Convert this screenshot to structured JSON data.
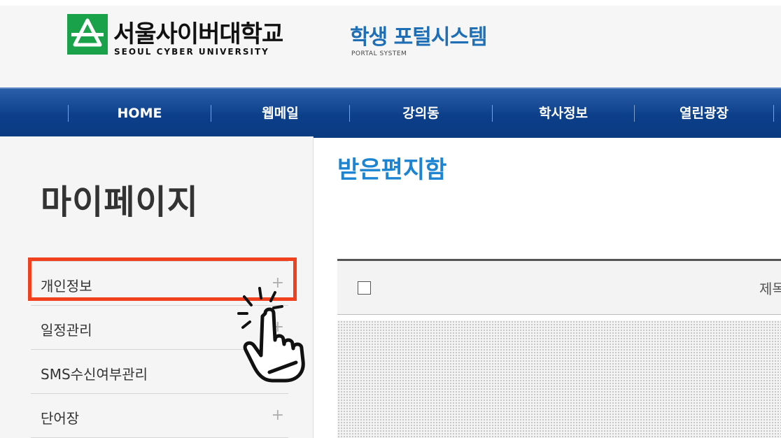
{
  "header": {
    "logo_korean": "서울사이버대학교",
    "logo_english": "SEOUL CYBER UNIVERSITY",
    "portal_korean": "학생 포털시스템",
    "portal_english": "PORTAL SYSTEM"
  },
  "nav": {
    "items": [
      "HOME",
      "웹메일",
      "강의동",
      "학사정보",
      "열린광장"
    ]
  },
  "sidebar": {
    "title": "마이페이지",
    "items": [
      {
        "label": "개인정보",
        "icon": "plus-icon"
      },
      {
        "label": "일정관리",
        "icon": "plus-icon"
      },
      {
        "label": "SMS수신여부관리",
        "icon": "plus-icon"
      },
      {
        "label": "단어장",
        "icon": "plus-icon"
      }
    ]
  },
  "main": {
    "title": "받은편지함",
    "table_header": {
      "subject_column": "제목"
    }
  },
  "colors": {
    "brand_green": "#19a24a",
    "nav_blue": "#0c3f8a",
    "title_blue": "#1d84d2",
    "highlight": "#f0401d"
  }
}
